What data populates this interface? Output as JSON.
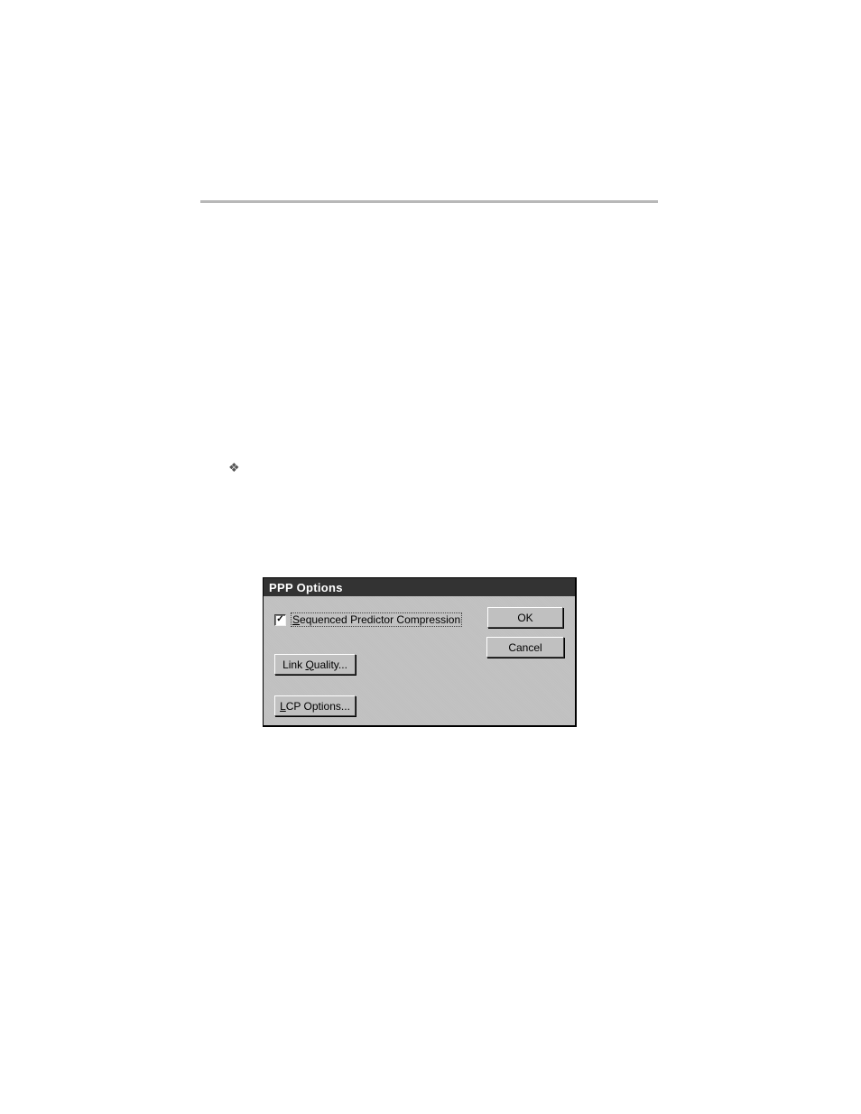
{
  "dialog": {
    "title": "PPP Options",
    "checkbox_label_prefix": "S",
    "checkbox_label_rest": "equenced Predictor Compression",
    "link_quality_prefix": "Link ",
    "link_quality_under": "Q",
    "link_quality_rest": "uality...",
    "lcp_under": "L",
    "lcp_rest": "CP Options...",
    "ok_label": "OK",
    "cancel_label": "Cancel"
  }
}
